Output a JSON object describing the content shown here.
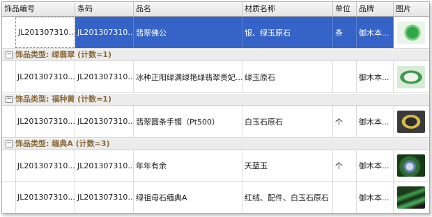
{
  "columns": [
    "饰品编号",
    "条码",
    "品名",
    "材质名称",
    "单位",
    "品牌",
    "图片"
  ],
  "rows": {
    "r1": {
      "id": "JL201307310...",
      "barcode": "JL201307310...",
      "name": "翡翠佛公",
      "material": "银、绿玉原石",
      "unit": "条",
      "brand": "御木本...",
      "photo": "green jade pendant photo"
    },
    "r2": {
      "id": "JL201307310...",
      "barcode": "JL201307310...",
      "name": "冰种正阳绿满绿艳绿翡翠贵妃...",
      "material": "绿玉原石",
      "unit": "",
      "brand": "御木本...",
      "photo": "green jade bangle photo"
    },
    "r3": {
      "id": "JL201307310...",
      "barcode": "JL201307310...",
      "name": "翡翠圆条手镯（Pt500）",
      "material": "白玉石原石",
      "unit": "个",
      "brand": "御木本...",
      "photo": "yellow jade bangle photo"
    },
    "r4": {
      "id": "JL201307310...",
      "barcode": "JL201307310...",
      "name": "年年有余",
      "material": "天蓝玉",
      "unit": "个",
      "brand": "御木本...",
      "photo": "jade carving on green background photo"
    },
    "r5": {
      "id": "JL201307310...",
      "barcode": "JL201307310...",
      "name": "绿祖母石缅典A",
      "material": "红绒、配件、白玉石原石",
      "unit": "",
      "brand": "御木本...",
      "photo": "jade necklace photo"
    }
  },
  "groups": {
    "g1": {
      "label": "饰品类型: 绿翡翠 (计数=1)",
      "expander": "−"
    },
    "g2": {
      "label": "饰品类型: 福种黄 (计数=1)",
      "expander": "−"
    },
    "g3": {
      "label": "饰品类型: 缅典A (计数=3)",
      "expander": "−"
    }
  },
  "colors": {
    "selection": "#3563c7",
    "group_text": "#8a6a3c",
    "group_bg": "#ececec"
  }
}
